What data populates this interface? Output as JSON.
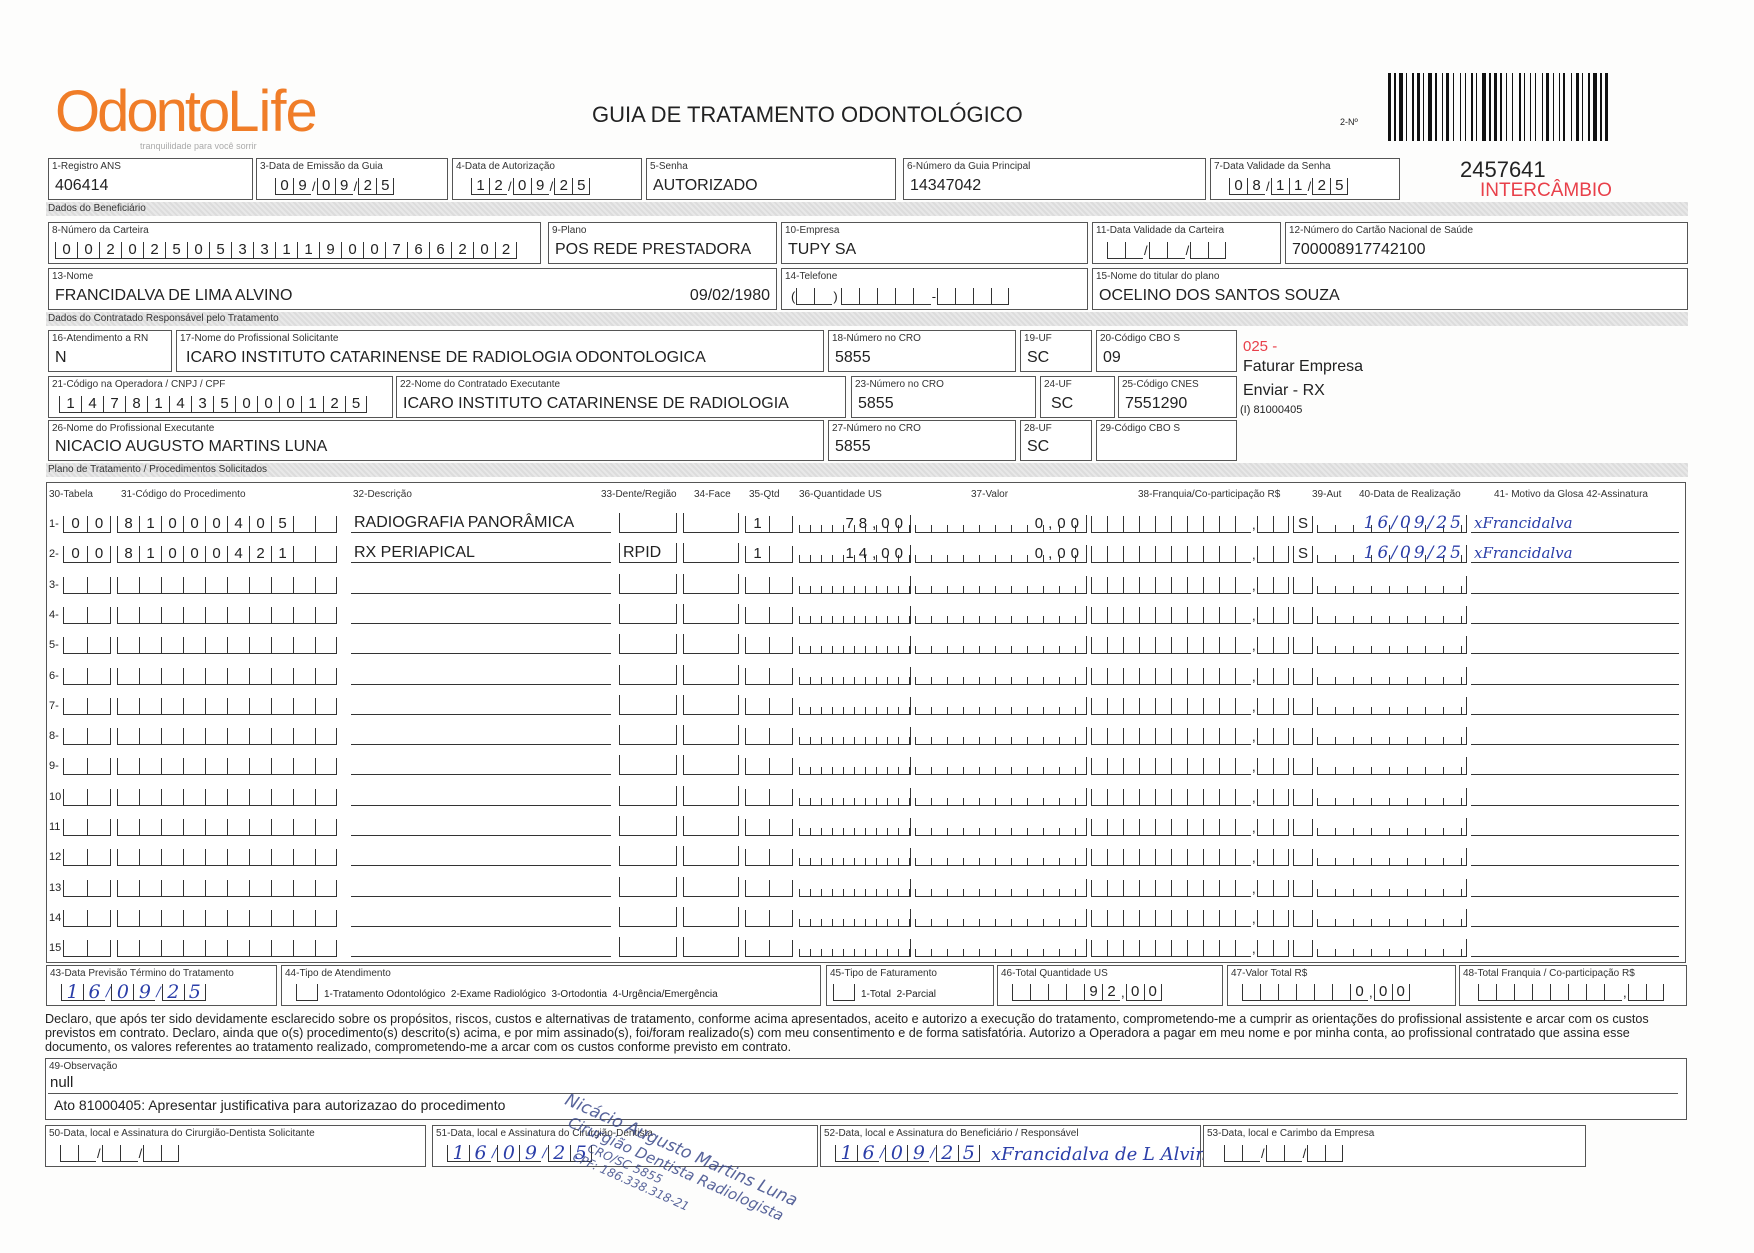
{
  "header": {
    "logo": {
      "part1": "Odonto",
      "part2": "Life",
      "tagline": "tranquilidade para você sorrir"
    },
    "title": "GUIA DE TRATAMENTO ODONTOLÓGICO",
    "guide_no_label": "2-Nº",
    "guide_no": "2457641",
    "intercambio": "INTERCÂMBIO",
    "accent_color": "#e8404a"
  },
  "fields": {
    "registro_ans": {
      "label": "1-Registro ANS",
      "value": "406414"
    },
    "data_emissao": {
      "label": "3-Data de Emissão da Guia",
      "value": "09/09/25"
    },
    "data_autorizacao": {
      "label": "4-Data de Autorização",
      "value": "12/09/25"
    },
    "senha": {
      "label": "5-Senha",
      "value": "AUTORIZADO"
    },
    "guia_principal": {
      "label": "6-Número da Guia Principal",
      "value": "14347042"
    },
    "validade_senha": {
      "label": "7-Data Validade da Senha",
      "value": "08/11/25"
    }
  },
  "beneficiario": {
    "section": "Dados do Beneficiário",
    "carteira": {
      "label": "8-Número da Carteira",
      "value": "002025053311900766202"
    },
    "plano": {
      "label": "9-Plano",
      "value": "POS REDE PRESTADORA"
    },
    "empresa": {
      "label": "10-Empresa",
      "value": "TUPY SA"
    },
    "validade_carteira": {
      "label": "11-Data Validade da Carteira",
      "value": ""
    },
    "cns": {
      "label": "12-Número do Cartão Nacional de Saúde",
      "value": "700008917742100"
    },
    "nome": {
      "label": "13-Nome",
      "value": "FRANCIDALVA DE LIMA ALVINO",
      "birth": "09/02/1980"
    },
    "telefone": {
      "label": "14-Telefone",
      "value": ""
    },
    "titular": {
      "label": "15-Nome do titular do plano",
      "value": "OCELINO DOS SANTOS SOUZA"
    }
  },
  "contratado": {
    "section": "Dados do Contratado Responsável pelo Tratamento",
    "atendimento_rn": {
      "label": "16-Atendimento a RN",
      "value": "N"
    },
    "prof_solicitante": {
      "label": "17-Nome do Profissional Solicitante",
      "value": "ICARO INSTITUTO CATARINENSE DE RADIOLOGIA ODONTOLOGICA"
    },
    "cro_18": {
      "label": "18-Número no CRO",
      "value": "5855"
    },
    "uf_19": {
      "label": "19-UF",
      "value": "SC"
    },
    "cbo_20": {
      "label": "20-Código CBO S",
      "value": "09"
    },
    "codigo_operadora": {
      "label": "21-Código na Operadora / CNPJ / CPF",
      "value": "14781435000125"
    },
    "contratado_executante": {
      "label": "22-Nome do Contratado Executante",
      "value": "ICARO INSTITUTO CATARINENSE DE RADIOLOGIA"
    },
    "cro_23": {
      "label": "23-Número no CRO",
      "value": "5855"
    },
    "uf_24": {
      "label": "24-UF",
      "value": "SC"
    },
    "cnes": {
      "label": "25-Código CNES",
      "value": "7551290"
    },
    "prof_executante": {
      "label": "26-Nome do Profissional Executante",
      "value": "NICACIO AUGUSTO MARTINS LUNA"
    },
    "cro_27": {
      "label": "27-Número no CRO",
      "value": "5855"
    },
    "uf_28": {
      "label": "28-UF",
      "value": "SC"
    },
    "cbo_29": {
      "label": "29-Código CBO S",
      "value": ""
    },
    "notes": {
      "code": "025 -",
      "faturar": "Faturar Empresa",
      "enviar": "Enviar - RX",
      "ref": "(I) 81000405"
    }
  },
  "procedures": {
    "section": "Plano de Tratamento / Procedimentos Solicitados",
    "headers": {
      "tabela": "30-Tabela",
      "codigo": "31-Código do Procedimento",
      "descricao": "32-Descrição",
      "dente": "33-Dente/Região",
      "face": "34-Face",
      "qtd": "35-Qtd",
      "qtd_us": "36-Quantidade US",
      "valor": "37-Valor",
      "franquia": "38-Franquia/Co-participação R$",
      "aut": "39-Aut",
      "data": "40-Data de Realização",
      "glosa_assinatura": "41- Motivo da Glosa 42-Assinatura"
    },
    "rows": [
      {
        "n": "1-",
        "tabela": "00",
        "codigo": "81000405",
        "descricao": "RADIOGRAFIA PANORÂMICA",
        "dente": "",
        "face": "",
        "qtd": "1",
        "qtd_us": "78,00",
        "valor": "0,00",
        "franquia": "",
        "aut": "S",
        "data": "16/09/25",
        "assinatura": "xFrancidalva"
      },
      {
        "n": "2-",
        "tabela": "00",
        "codigo": "81000421",
        "descricao": "RX PERIAPICAL",
        "dente": "RPID",
        "face": "",
        "qtd": "1",
        "qtd_us": "14,00",
        "valor": "0,00",
        "franquia": "",
        "aut": "S",
        "data": "16/09/25",
        "assinatura": "xFrancidalva"
      },
      {
        "n": "3-"
      },
      {
        "n": "4-"
      },
      {
        "n": "5-"
      },
      {
        "n": "6-"
      },
      {
        "n": "7-"
      },
      {
        "n": "8-"
      },
      {
        "n": "9-"
      },
      {
        "n": "10"
      },
      {
        "n": "11"
      },
      {
        "n": "12"
      },
      {
        "n": "13"
      },
      {
        "n": "14"
      },
      {
        "n": "15"
      }
    ]
  },
  "footer": {
    "previsao": {
      "label": "43-Data Previsão Término do Tratamento",
      "value": "16/09/25"
    },
    "tipo_atendimento": {
      "label": "44-Tipo de Atendimento",
      "options": "1-Tratamento Odontológico  2-Exame Radiológico  3-Ortodontia  4-Urgência/Emergência"
    },
    "tipo_faturamento": {
      "label": "45-Tipo de Faturamento",
      "options": "1-Total  2-Parcial"
    },
    "total_us": {
      "label": "46-Total Quantidade US",
      "value": "92,00"
    },
    "valor_total": {
      "label": "47-Valor Total R$",
      "value": "0,00"
    },
    "total_franquia": {
      "label": "48-Total Franquia / Co-participação R$",
      "value": ""
    },
    "declaration": "Declaro, que após ter sido devidamente esclarecido sobre os propósitos, riscos, custos e alternativas de tratamento, conforme acima apresentados, aceito e autorizo a execução do tratamento, comprometendo-me a cumprir as orientações do profissional assistente e arcar com os custos previstos em contrato. Declaro, ainda que o(s) procedimento(s) descrito(s) acima, e por mim assinado(s), foi/foram realizado(s) com meu consentimento e de forma satisfatória. Autorizo a Operadora a pagar em meu nome e por minha conta, ao profissional contratado que assina esse documento, os valores referentes ao tratamento realizado, comprometendo-me a arcar com os custos conforme previsto em contrato.",
    "observacao": {
      "label": "49-Observação",
      "value": "null",
      "line2": "Ato 81000405: Apresentar justificativa para autorizazao do procedimento"
    },
    "sig50": {
      "label": "50-Data, local e Assinatura do Cirurgião-Dentista Solicitante",
      "value": ""
    },
    "sig51": {
      "label": "51-Data, local e Assinatura do Cirurgião-Dentista",
      "value": "16/09/25"
    },
    "sig52": {
      "label": "52-Data, local e Assinatura do Beneficiário / Responsável",
      "value": "16/09/25",
      "signature": "xFrancidalva de L Alvino"
    },
    "sig53": {
      "label": "53-Data, local e Carimbo da Empresa",
      "value": ""
    },
    "stamp": {
      "name": "Nicácio Augusto Martins Luna",
      "title": "Cirurgião Dentista Radiologista",
      "cro": "CRO/SC 5855",
      "cpf": "CPF: 186.338.318-21"
    }
  }
}
